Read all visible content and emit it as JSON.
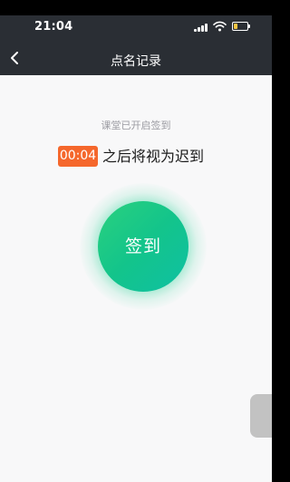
{
  "status_bar": {
    "time": "21:04"
  },
  "nav": {
    "title": "点名记录"
  },
  "attendance": {
    "hint": "课堂已开启签到",
    "countdown": "00:04",
    "late_text": "之后将视为迟到",
    "checkin_label": "签到"
  },
  "icons": {
    "back": "chevron-left-icon",
    "signal": "signal-icon",
    "wifi": "wifi-icon",
    "battery": "battery-icon"
  },
  "colors": {
    "header_bg": "#2a2e34",
    "countdown_bg": "#f5672c",
    "checkin_green": "#13c48b"
  }
}
